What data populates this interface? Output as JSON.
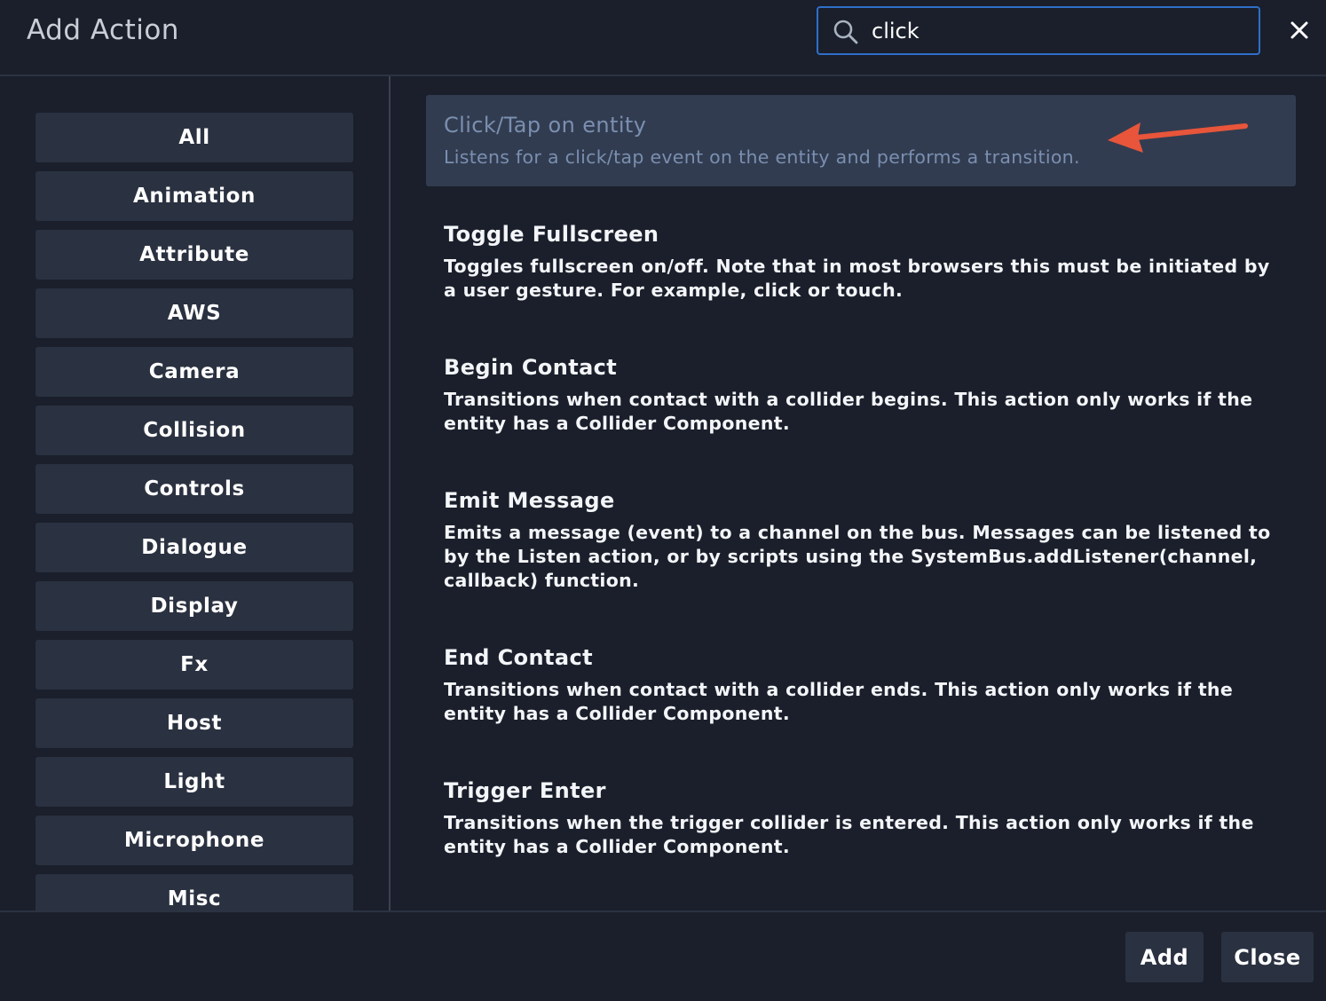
{
  "dialog": {
    "title": "Add Action"
  },
  "search": {
    "value": "click",
    "icon": "search-icon"
  },
  "categories": [
    "All",
    "Animation",
    "Attribute",
    "AWS",
    "Camera",
    "Collision",
    "Controls",
    "Dialogue",
    "Display",
    "Fx",
    "Host",
    "Light",
    "Microphone",
    "Misc"
  ],
  "actions": [
    {
      "title": "Click/Tap on entity",
      "description": "Listens for a click/tap event on the entity and performs a transition.",
      "selected": true
    },
    {
      "title": "Toggle Fullscreen",
      "description": "Toggles fullscreen on/off. Note that in most browsers this must be initiated by a user gesture. For example, click or touch."
    },
    {
      "title": "Begin Contact",
      "description": "Transitions when contact with a collider begins. This action only works if the entity has a Collider Component."
    },
    {
      "title": "Emit Message",
      "description": "Emits a message (event) to a channel on the bus. Messages can be listened to by the Listen action, or by scripts using the SystemBus.addListener(channel, callback) function."
    },
    {
      "title": "End Contact",
      "description": "Transitions when contact with a collider ends. This action only works if the entity has a Collider Component."
    },
    {
      "title": "Trigger Enter",
      "description": "Transitions when the trigger collider is entered. This action only works if the entity has a Collider Component."
    }
  ],
  "footer": {
    "add_label": "Add",
    "close_label": "Close"
  },
  "colors": {
    "background": "#1a1f2b",
    "button": "#2a3140",
    "selected": "#323c50",
    "focus": "#2f6fc9",
    "arrow": "#e8553a"
  }
}
